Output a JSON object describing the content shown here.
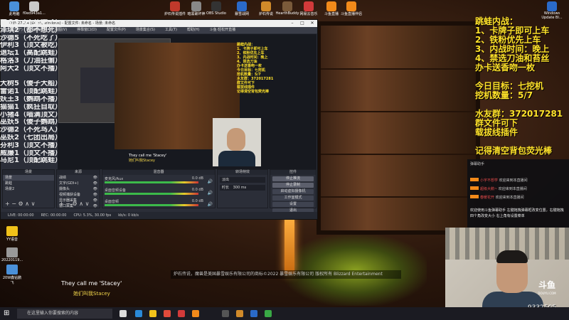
{
  "desktop_top_icons": [
    {
      "label": "此电脑",
      "color": "#4a90d9"
    },
    {
      "label": "f0ed943a1...",
      "color": "#c9c9c9"
    },
    {
      "label": "炉石传说插件",
      "color": "#c0392b"
    },
    {
      "label": "暗黑破坏神",
      "color": "#888888"
    },
    {
      "label": "OBS Studio",
      "color": "#333333"
    },
    {
      "label": "暴雪战网",
      "color": "#2a6ac9"
    },
    {
      "label": "炉石传说",
      "color": "#d08a2a"
    },
    {
      "label": "HearthBuddy",
      "color": "#7a5a3a"
    },
    {
      "label": "网易云音乐",
      "color": "#d13a3a"
    },
    {
      "label": "斗鱼直播",
      "color": "#f28a1a"
    },
    {
      "label": "斗鱼直播伴侣",
      "color": "#f28a1a"
    },
    {
      "label": "Windows Update Bl...",
      "color": "#2a6ac9"
    }
  ],
  "desktop_left_icons": [
    {
      "label": "YY语音",
      "color": "#f2c21a"
    },
    {
      "label": "20220119...",
      "color": "#999999"
    },
    {
      "label": "20W鑫钻鹏飞",
      "color": "#4a90d9"
    }
  ],
  "overlay_right": {
    "lines": [
      "跳蛙内战：",
      "1、卡牌子即可上车",
      "2、铁粉优先上车",
      "3、内战时间：晚上",
      "4、禁选刀油和苔丝",
      "办卡送香吻一枚",
      "",
      "今日目标：七挖机",
      "挖机数量：5/7",
      "",
      "水友群：372017281",
      "群文件可下",
      "载拔线插件",
      "",
      "记得清空背包荧光棒"
    ]
  },
  "overlay_left": {
    "lines": [
      "曲奇3（不死吃了）",
      "泽琪2（都不想死）",
      "沙德5（不死吃了）",
      "伊利3（顶文被吃）",
      "退坛1（高配跳蛙）",
      "格洛3（刀油狂偷）",
      "阿大2（顶文不播）",
      "",
      "大树5（傻子大船）",
      "雷诺1（顶配跳蛙）",
      "妖王3（鹦鹉不播）",
      "猫猫1（疯狂自取）",
      "小猪4（喵满顶文）",
      "巫妖5（傻子鹦鹉）",
      "沙德2（不死鸟人）",
      "巫妖2（七团出局）",
      "芬利3（顶文不播）",
      "威廉1（顶文不播）",
      "马尼1（顶配跳蛙）"
    ]
  },
  "obs": {
    "title": "OBS 27.2.4 (64 bit, windows) - 配置文件: 未命名 - 场景: 未命名",
    "menu": [
      "文件(F)",
      "编辑(E)",
      "视图(V)",
      "停靠窗口(D)",
      "配置文件(P)",
      "场景集合(S)",
      "工具(T)",
      "帮助(H)",
      "斗鱼·轻松开直播"
    ],
    "preview_text": [
      "跳蛙内战：",
      "1、卡牌子即可上车",
      "2、铁粉优先上车",
      "3、内战时间：晚上",
      "4、禁选刀油",
      "办卡送香吻一枚",
      "今日目标：七挖机",
      "挖机数量：5/7",
      "水友群：372017281",
      "群文件可下",
      "载拔线插件",
      "记得清空背包荧光棒"
    ],
    "preview_sub": [
      "They call me 'Stacey'",
      "她们叫我Stacey"
    ],
    "docks": {
      "scenes": "场景",
      "sources": "来源",
      "mixer": "混音器",
      "transitions": "转场特效",
      "controls": "控件"
    },
    "scenes": [
      "场景",
      "跳蛙",
      "场景2"
    ],
    "sources": [
      {
        "label": "战绩"
      },
      {
        "label": "文字(GDI+)"
      },
      {
        "label": "摄像头"
      },
      {
        "label": "视频捕获设备"
      },
      {
        "label": "显示器采集"
      },
      {
        "label": "窗口采集"
      }
    ],
    "mixer": [
      {
        "label": "麦克风/Aux",
        "value": "0.0 dB"
      },
      {
        "label": "桌面音频设备",
        "value": "0.0 dB"
      },
      {
        "label": "桌面音频",
        "value": "0.0 dB"
      }
    ],
    "transition": {
      "type": "淡出",
      "duration_label": "时长",
      "duration": "300 ms"
    },
    "controls": [
      "停止推流",
      "停止录制",
      "启动虚拟摄像机",
      "工作室模式",
      "设置",
      "退出"
    ],
    "status": [
      "LIVE: 00:00:00",
      "REC: 00:00:00",
      "CPU: 5.3%, 30.00 fps",
      "kb/s: 0 kb/s"
    ]
  },
  "game_text": "炉石传说，魔兽是美国暴雪娱乐有限公司的商标©2022 暴雪娱乐有限公司 版权所有 Blizzard Entertainment",
  "chat": {
    "title": "弹幕助手",
    "rows": [
      {
        "name": "小宇不想学",
        "text": "欢迎来到本直播间"
      },
      {
        "name": "超级大鹅~",
        "text": "欢迎来到本直播间"
      },
      {
        "name": "春暖花开",
        "text": "欢迎来到本直播间"
      }
    ],
    "notice": "欢迎使用斗鱼弹幕助手 左键拖拽弹幕框改变位置，右键拖拽四个角改变大小 右上角有设置菜单"
  },
  "webcam": {
    "logo": "斗鱼",
    "logo_sub": "DOUYU.COM",
    "viewer_count": "9332505"
  },
  "subtitles": {
    "en": "They call me 'Stacey'",
    "cn": "她们叫我Stacey"
  },
  "taskbar": {
    "search_placeholder": "在这里输入你要搜索的内容",
    "icons": [
      {
        "name": "task-view-icon",
        "color": "#dddddd"
      },
      {
        "name": "edge-icon",
        "color": "#2a8ad9"
      },
      {
        "name": "explorer-icon",
        "color": "#f2c21a"
      },
      {
        "name": "chrome-icon",
        "color": "#e14b3b"
      },
      {
        "name": "netease-icon",
        "color": "#d13a3a"
      },
      {
        "name": "douyu-icon",
        "color": "#f28a1a"
      },
      {
        "name": "obs-icon",
        "color": "#555555"
      },
      {
        "name": "hearthstone-icon",
        "color": "#d08a2a"
      },
      {
        "name": "battlenet-icon",
        "color": "#2a6ac9"
      },
      {
        "name": "app-icon",
        "color": "#39a845"
      }
    ]
  }
}
